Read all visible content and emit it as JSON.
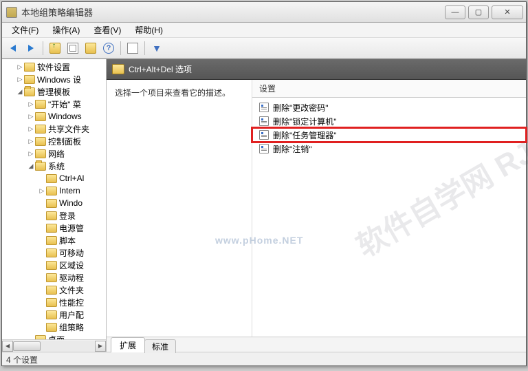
{
  "window": {
    "title": "本地组策略编辑器"
  },
  "menubar": [
    "文件(F)",
    "操作(A)",
    "查看(V)",
    "帮助(H)"
  ],
  "tree": [
    {
      "indent": 1,
      "toggle": "▷",
      "label": "软件设置"
    },
    {
      "indent": 1,
      "toggle": "▷",
      "label": "Windows 设"
    },
    {
      "indent": 1,
      "toggle": "◢",
      "label": "管理模板",
      "open": true
    },
    {
      "indent": 2,
      "toggle": "▷",
      "label": "\"开始\" 菜"
    },
    {
      "indent": 2,
      "toggle": "▷",
      "label": "Windows"
    },
    {
      "indent": 2,
      "toggle": "▷",
      "label": "共享文件夹"
    },
    {
      "indent": 2,
      "toggle": "▷",
      "label": "控制面板"
    },
    {
      "indent": 2,
      "toggle": "▷",
      "label": "网络"
    },
    {
      "indent": 2,
      "toggle": "◢",
      "label": "系统",
      "open": true
    },
    {
      "indent": 3,
      "toggle": "",
      "label": "Ctrl+Al"
    },
    {
      "indent": 3,
      "toggle": "▷",
      "label": "Intern"
    },
    {
      "indent": 3,
      "toggle": "",
      "label": "Windo"
    },
    {
      "indent": 3,
      "toggle": "",
      "label": "登录"
    },
    {
      "indent": 3,
      "toggle": "",
      "label": "电源管"
    },
    {
      "indent": 3,
      "toggle": "",
      "label": "脚本"
    },
    {
      "indent": 3,
      "toggle": "",
      "label": "可移动"
    },
    {
      "indent": 3,
      "toggle": "",
      "label": "区域设"
    },
    {
      "indent": 3,
      "toggle": "",
      "label": "驱动程"
    },
    {
      "indent": 3,
      "toggle": "",
      "label": "文件夹"
    },
    {
      "indent": 3,
      "toggle": "",
      "label": "性能控"
    },
    {
      "indent": 3,
      "toggle": "",
      "label": "用户配"
    },
    {
      "indent": 3,
      "toggle": "",
      "label": "组策略"
    },
    {
      "indent": 2,
      "toggle": "",
      "label": "桌面"
    }
  ],
  "path": "Ctrl+Alt+Del 选项",
  "desc_prompt": "选择一个项目来查看它的描述。",
  "settings_header": "设置",
  "settings": [
    {
      "label": "删除\"更改密码\""
    },
    {
      "label": "删除\"锁定计算机\""
    },
    {
      "label": "删除\"任务管理器\"",
      "highlight": true
    },
    {
      "label": "删除\"注销\""
    }
  ],
  "tabs": {
    "active": "扩展",
    "inactive": "标准"
  },
  "status": "4 个设置",
  "watermark": "www.pHome.NET",
  "watermark_side": "软件自学网 RJZXW.com"
}
